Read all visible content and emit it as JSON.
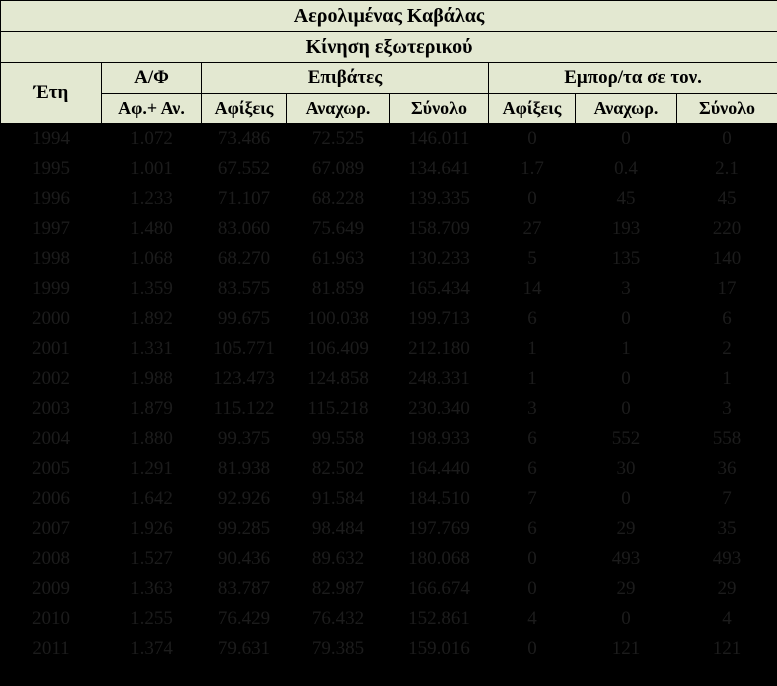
{
  "title": "Αερολιμένας Καβάλας",
  "subtitle": "Κίνηση εξωτερικού",
  "headers": {
    "years": "Έτη",
    "aircraft_group": "Α/Φ",
    "passengers_group": "Επιβάτες",
    "cargo_group": "Εμπορ/τα σε τον.",
    "aircraft_sub": "Αφ.+ Αν.",
    "arrivals": "Αφίξεις",
    "departures": "Αναχωρ.",
    "total": "Σύνολο",
    "cargo_arrivals": "Αφίξεις",
    "cargo_departures": "Αναχωρ.",
    "cargo_total": "Σύνολο"
  },
  "rows": [
    [
      "1994",
      "1.072",
      "73.486",
      "72.525",
      "146.011",
      "0",
      "0",
      "0"
    ],
    [
      "1995",
      "1.001",
      "67.552",
      "67.089",
      "134.641",
      "1.7",
      "0.4",
      "2.1"
    ],
    [
      "1996",
      "1.233",
      "71.107",
      "68.228",
      "139.335",
      "0",
      "45",
      "45"
    ],
    [
      "1997",
      "1.480",
      "83.060",
      "75.649",
      "158.709",
      "27",
      "193",
      "220"
    ],
    [
      "1998",
      "1.068",
      "68.270",
      "61.963",
      "130.233",
      "5",
      "135",
      "140"
    ],
    [
      "1999",
      "1.359",
      "83.575",
      "81.859",
      "165.434",
      "14",
      "3",
      "17"
    ],
    [
      "2000",
      "1.892",
      "99.675",
      "100.038",
      "199.713",
      "6",
      "0",
      "6"
    ],
    [
      "2001",
      "1.331",
      "105.771",
      "106.409",
      "212.180",
      "1",
      "1",
      "2"
    ],
    [
      "2002",
      "1.988",
      "123.473",
      "124.858",
      "248.331",
      "1",
      "0",
      "1"
    ],
    [
      "2003",
      "1.879",
      "115.122",
      "115.218",
      "230.340",
      "3",
      "0",
      "3"
    ],
    [
      "2004",
      "1.880",
      "99.375",
      "99.558",
      "198.933",
      "6",
      "552",
      "558"
    ],
    [
      "2005",
      "1.291",
      "81.938",
      "82.502",
      "164.440",
      "6",
      "30",
      "36"
    ],
    [
      "2006",
      "1.642",
      "92.926",
      "91.584",
      "184.510",
      "7",
      "0",
      "7"
    ],
    [
      "2007",
      "1.926",
      "99.285",
      "98.484",
      "197.769",
      "6",
      "29",
      "35"
    ],
    [
      "2008",
      "1.527",
      "90.436",
      "89.632",
      "180.068",
      "0",
      "493",
      "493"
    ],
    [
      "2009",
      "1.363",
      "83.787",
      "82.987",
      "166.674",
      "0",
      "29",
      "29"
    ],
    [
      "2010",
      "1.255",
      "76.429",
      "76.432",
      "152.861",
      "4",
      "0",
      "4"
    ],
    [
      "2011",
      "1.374",
      "79.631",
      "79.385",
      "159.016",
      "0",
      "121",
      "121"
    ]
  ]
}
